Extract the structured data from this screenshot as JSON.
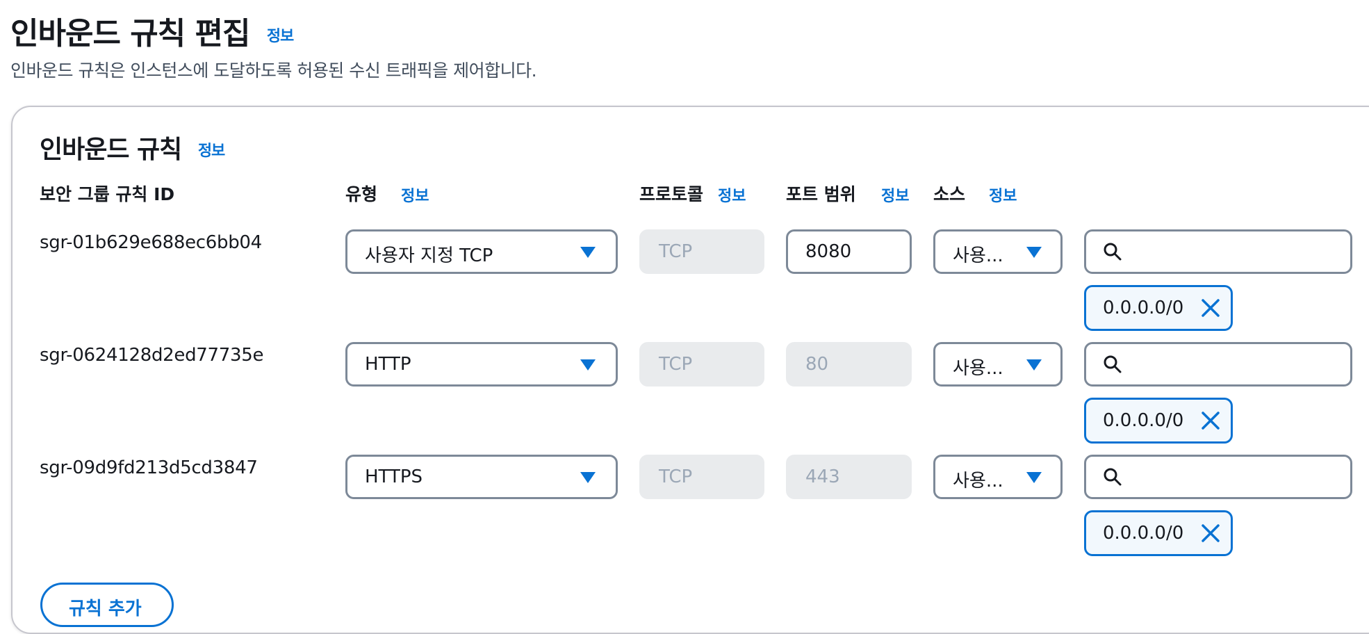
{
  "header": {
    "title": "인바운드 규칙 편집",
    "info_label": "정보",
    "description": "인바운드 규칙은 인스턴스에 도달하도록 허용된 수신 트래픽을 제어합니다."
  },
  "panel": {
    "title": "인바운드 규칙",
    "info_label": "정보",
    "columns": {
      "rule_id": "보안 그룹 규칙 ID",
      "type": "유형",
      "protocol": "프로토콜",
      "port_range": "포트 범위",
      "source": "소스",
      "info_label": "정보"
    },
    "rules": [
      {
        "id": "sgr-01b629e688ec6bb04",
        "type": "사용자 지정 TCP",
        "protocol": "TCP",
        "port": "8080",
        "source": "사용...",
        "cidr": "0.0.0.0/0"
      },
      {
        "id": "sgr-0624128d2ed77735e",
        "type": "HTTP",
        "protocol": "TCP",
        "port": "80",
        "source": "사용...",
        "cidr": "0.0.0.0/0"
      },
      {
        "id": "sgr-09d9fd213d5cd3847",
        "type": "HTTPS",
        "protocol": "TCP",
        "port": "443",
        "source": "사용...",
        "cidr": "0.0.0.0/0"
      }
    ],
    "add_button": "규칙 추가"
  },
  "colors": {
    "accent": "#0972d3",
    "border": "#7d8998",
    "disabled_bg": "#e9ebed",
    "text": "#16191f"
  },
  "icons": {
    "select_caret": "caret-down-icon",
    "search": "search-icon",
    "remove_token": "close-icon"
  }
}
